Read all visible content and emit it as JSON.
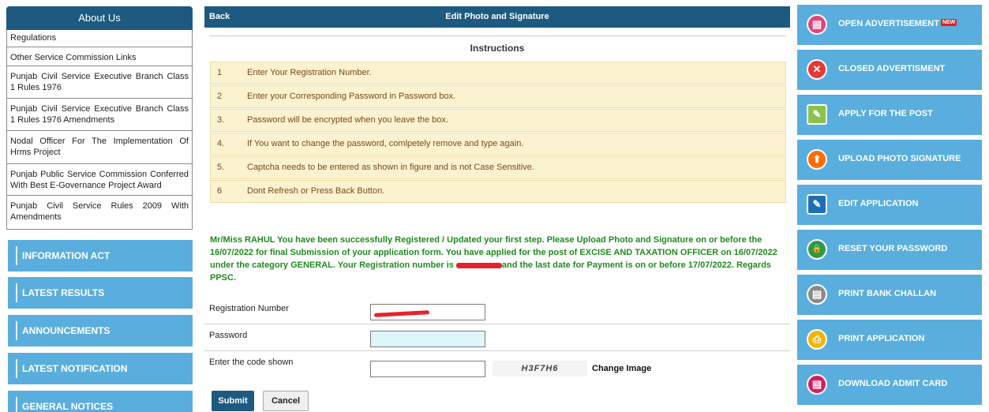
{
  "about": {
    "heading": "About Us",
    "items": [
      "Regulations",
      "Other Service Commission Links",
      "Punjab Civil Service Executive Branch Class 1 Rules 1976",
      "Punjab Civil Service Executive Branch Class 1 Rules 1976 Amendments",
      "Nodal Officer For The Implementation Of Hrms Project",
      "Punjab Public Service Commission Conferred With Best E-Governance Project Award",
      "Punjab Civil Service Rules 2009 With Amendments"
    ]
  },
  "left_nav": [
    "INFORMATION ACT",
    "LATEST RESULTS",
    "ANNOUNCEMENTS",
    "LATEST NOTIFICATION",
    "GENERAL NOTICES"
  ],
  "header": {
    "back": "Back",
    "title": "Edit Photo and Signature"
  },
  "instructions": {
    "title": "Instructions",
    "rows": [
      {
        "n": "1",
        "text": "Enter Your Registration Number."
      },
      {
        "n": "2",
        "text": "Enter your Corresponding Password in Password box."
      },
      {
        "n": "3.",
        "text": "Password will be encrypted when you leave the box."
      },
      {
        "n": "4.",
        "text": "If You want to change the password, comlpetely remove and type again."
      },
      {
        "n": "5.",
        "text": "Captcha needs to be entered as shown in figure and is not Case Sensitive."
      },
      {
        "n": "6",
        "text": "Dont Refresh or Press Back Button."
      }
    ]
  },
  "message": {
    "part1": "Mr/Miss RAHUL You have been successfully Registered / Updated your first step. Please Upload Photo and Signature on or before the 16/07/2022 for final Submission of your application form. You have applied for the post of EXCISE AND TAXATION OFFICER on 16/07/2022 under the category GENERAL. Your Registration number is ",
    "part2": "and the last date for Payment is on or before 17/07/2022. Regards PPSC."
  },
  "form": {
    "reg_label": "Registration Number",
    "pass_label": "Password",
    "code_label": "Enter the code shown",
    "captcha_text": "H3F7H6",
    "change_image": "Change Image",
    "submit": "Submit",
    "cancel": "Cancel"
  },
  "right_nav": [
    {
      "label": "OPEN ADVERTISEMENT",
      "badge": "NEW",
      "color": "#e0457b",
      "icon": "advertisement-icon",
      "glyph": "▤"
    },
    {
      "label": "CLOSED ADVERTISMENT",
      "color": "#e53935",
      "icon": "close-icon",
      "glyph": "✕"
    },
    {
      "label": "APPLY FOR THE POST",
      "color": "#8bc34a",
      "icon": "apply-form-icon",
      "glyph": "✎"
    },
    {
      "label": "UPLOAD PHOTO SIGNATURE",
      "color": "#ff6d00",
      "icon": "upload-arrow-icon",
      "glyph": "⬆"
    },
    {
      "label": "EDIT APPLICATION",
      "color": "#1e6fb8",
      "icon": "edit-icon",
      "glyph": "✎"
    },
    {
      "label": "RESET YOUR PASSWORD",
      "color": "#2e9a44",
      "icon": "lock-icon",
      "glyph": "🔒"
    },
    {
      "label": "PRINT BANK CHALLAN",
      "color": "#8a8a8a",
      "icon": "challan-icon",
      "glyph": "▤"
    },
    {
      "label": "PRINT APPLICATION",
      "color": "#f4b400",
      "icon": "print-icon",
      "glyph": "⎙"
    },
    {
      "label": "DOWNLOAD ADMIT CARD",
      "color": "#d81b60",
      "icon": "admit-card-icon",
      "glyph": "▤"
    }
  ]
}
